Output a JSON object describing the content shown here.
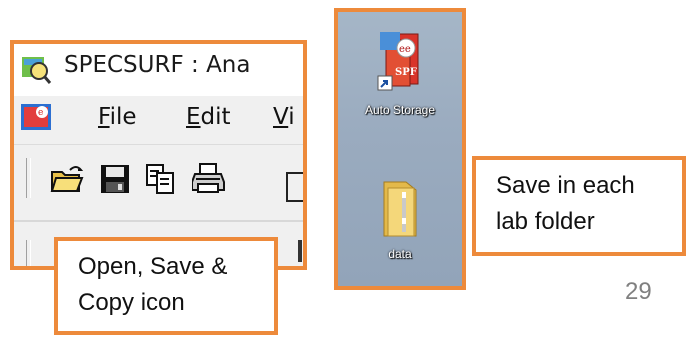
{
  "app_window": {
    "title": "SPECSURF : Ana",
    "menu": {
      "file": {
        "hotkey": "F",
        "rest": "ile"
      },
      "edit": {
        "hotkey": "E",
        "rest": "dit"
      },
      "view": {
        "hotkey": "V",
        "rest": "i"
      }
    },
    "toolbar_icons": [
      "open-folder-icon",
      "save-icon",
      "copy-icon",
      "print-icon"
    ]
  },
  "desktop": {
    "icons": [
      {
        "label": "Auto Storage",
        "icon": "spf-shortcut-icon"
      },
      {
        "label": "data",
        "icon": "folder-icon"
      }
    ]
  },
  "callouts": {
    "left": "Open, Save &\nCopy icon",
    "right": "Save in each\nlab folder"
  },
  "slide": {
    "page_number": "29"
  },
  "colors": {
    "accent_border": "#ED8A3B",
    "desktop_bg": "#9aabbf",
    "toolbar_bg": "#F0F0F0"
  }
}
